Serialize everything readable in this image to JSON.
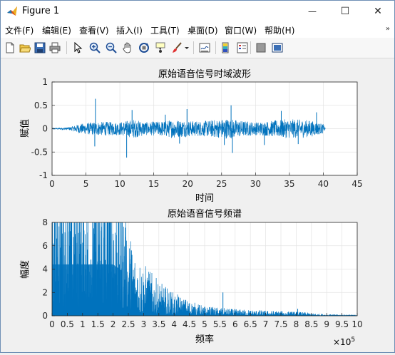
{
  "window": {
    "title": "Figure 1",
    "minimize_glyph": "—",
    "maximize_glyph": "☐",
    "close_glyph": "✕"
  },
  "menu": {
    "items": [
      "文件(F)",
      "编辑(E)",
      "查看(V)",
      "插入(I)",
      "工具(T)",
      "桌面(D)",
      "窗口(W)",
      "帮助(H)"
    ],
    "overflow_glyph": "»"
  },
  "toolbar": {
    "icons": [
      "new-figure-icon",
      "open-file-icon",
      "save-icon",
      "print-icon",
      "pointer-icon",
      "zoom-in-icon",
      "zoom-out-icon",
      "pan-icon",
      "rotate-3d-icon",
      "data-cursor-icon",
      "brush-icon",
      "link-plot-icon",
      "colorbar-icon",
      "legend-icon",
      "hide-plot-tools-icon",
      "show-plot-tools-icon"
    ]
  },
  "chart_data": [
    {
      "type": "line",
      "title": "原始语音信号时域波形",
      "xlabel": "时间",
      "ylabel": "赋值",
      "xlim": [
        0,
        45
      ],
      "ylim": [
        -1,
        1
      ],
      "xticks": [
        "0",
        "5",
        "10",
        "15",
        "20",
        "25",
        "30",
        "35",
        "40",
        "45"
      ],
      "yticks": [
        "1",
        "0.5",
        "0",
        "-0.5",
        "-1"
      ],
      "grid": true,
      "color": "#0072bd",
      "signal_range": [
        0,
        40.3
      ],
      "envelope": {
        "t": [
          0,
          2.5,
          4,
          6,
          8,
          10,
          12,
          14,
          16,
          18,
          20,
          22,
          24,
          26,
          28,
          30,
          32,
          34,
          36,
          38,
          40,
          40.3
        ],
        "amplitude": [
          0.01,
          0.03,
          0.1,
          0.14,
          0.15,
          0.14,
          0.2,
          0.14,
          0.16,
          0.2,
          0.17,
          0.16,
          0.19,
          0.22,
          0.17,
          0.14,
          0.16,
          0.2,
          0.2,
          0.18,
          0.1,
          0.01
        ]
      },
      "spikes": [
        {
          "t": 6.4,
          "y": 0.64
        },
        {
          "t": 6.3,
          "y": -0.38
        },
        {
          "t": 11.0,
          "y": -0.62
        },
        {
          "t": 11.8,
          "y": 0.4
        },
        {
          "t": 19.9,
          "y": 0.42
        },
        {
          "t": 16.7,
          "y": 0.3
        },
        {
          "t": 18.8,
          "y": -0.32
        },
        {
          "t": 26.4,
          "y": 0.5
        },
        {
          "t": 26.6,
          "y": -0.52
        },
        {
          "t": 25.4,
          "y": -0.35
        },
        {
          "t": 31.3,
          "y": -0.35
        },
        {
          "t": 33.8,
          "y": 0.38
        },
        {
          "t": 36.3,
          "y": -0.33
        },
        {
          "t": 39.0,
          "y": 0.35
        }
      ]
    },
    {
      "type": "line",
      "title": "原始语音信号频谱",
      "xlabel": "频率",
      "ylabel": "幅度",
      "xlim": [
        0,
        10
      ],
      "ylim": [
        0,
        8
      ],
      "xticks": [
        "0",
        "0.5",
        "1",
        "1.5",
        "2",
        "2.5",
        "3",
        "3.5",
        "4",
        "4.5",
        "5",
        "5.5",
        "6",
        "6.5",
        "7",
        "7.5",
        "8",
        "8.5",
        "9",
        "9.5",
        "10"
      ],
      "yticks": [
        "8",
        "6",
        "4",
        "2",
        "0"
      ],
      "x_exponent_label": "×10",
      "x_exponent_power": "5",
      "grid": true,
      "color": "#0072bd",
      "envelope": {
        "f": [
          0,
          0.5,
          1.0,
          1.5,
          2.0,
          2.3,
          2.5,
          2.8,
          3.0,
          3.5,
          4.0,
          4.5,
          5.0,
          6.0,
          7.0,
          8.0,
          9.0,
          10.0
        ],
        "amplitude": [
          8,
          8,
          8,
          8,
          8,
          7,
          4.5,
          3.2,
          2.8,
          1.8,
          1.2,
          0.8,
          0.5,
          0.35,
          0.28,
          0.22,
          0.08,
          0.05
        ]
      },
      "peaks": [
        {
          "f": 5.6,
          "y": 2.0
        },
        {
          "f": 2.6,
          "y": 5.6
        },
        {
          "f": 3.2,
          "y": 3.6
        },
        {
          "f": 8.05,
          "y": 0.6
        }
      ]
    }
  ]
}
